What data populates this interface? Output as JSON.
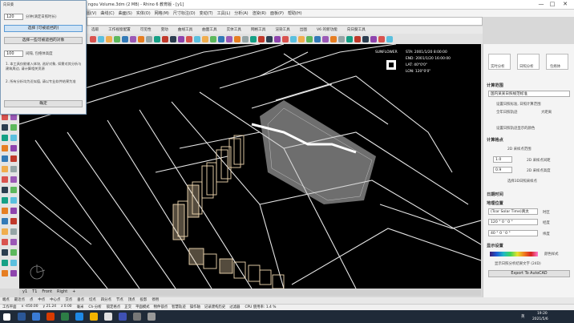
{
  "window": {
    "title": "ngou Volume.3dm (2 MB) - Rhino 6 教育版 - [y1]",
    "minimize": "—",
    "maximize": "□",
    "close": "✕"
  },
  "menubar": [
    "图(V)",
    "曲线(C)",
    "曲面(S)",
    "实体(O)",
    "网格(M)",
    "尺寸标注(D)",
    "变动(T)",
    "工具(L)",
    "分析(A)",
    "渲染(R)",
    "面板(P)",
    "帮助(H)"
  ],
  "ribbon_tabs": [
    "选取",
    "工作视窗配置",
    "可见性",
    "变动",
    "曲线工具",
    "曲面工具",
    "实体工具",
    "网格工具",
    "渲染工具",
    "出图",
    "V6 的新功能",
    "向日葵工具"
  ],
  "dialog": {
    "title": "向日葵",
    "row1_value": "120",
    "row1_label": "分钟(滴定日照时长)",
    "btn_select_objects": "选择 (可被遮挡的)",
    "btn_select_points": "选择一些可被遮挡的对象",
    "row2_value": "100",
    "row2_label": "间隔, 包络体高度",
    "note1": "1. 本工具仅能输入体块, 选好对象, 如需对其分析与建筑周边, 请计算相关资源",
    "note2": "2. 所有分析均为近似值, 请以专业软件结果为准",
    "ok": "确定"
  },
  "viewport": {
    "labels": [
      "SUNFLOWER",
      "STA: 2001/1/20 8:00:00",
      "END: 2001/1/20 16:00:00",
      "LAT: 40°0'0\"",
      "LON: 120°0'0\""
    ]
  },
  "viewport_tabs": [
    "y1",
    "T1",
    "Front",
    "Right",
    "+"
  ],
  "osnap": [
    "端点",
    "最近点",
    "点",
    "中点",
    "中心点",
    "交点",
    "垂点",
    "切点",
    "四分点",
    "节点",
    "顶点",
    "投影",
    "停用"
  ],
  "status": {
    "plane": "工作平面",
    "x": "x -450.00",
    "y": "y 21.24",
    "z": "z 0.00",
    "unit": "毫米",
    "layer": "Ch-分析",
    "toggles": [
      "锁定格点",
      "正交",
      "平面模式",
      "物件锁点",
      "智慧轨迹",
      "操作轴",
      "记录建构历史",
      "过滤器"
    ],
    "cpu": "CPU 使用率: 1.4 %"
  },
  "rightpanel": {
    "top_buttons": [
      "实时分析",
      "日照分析",
      "包络体"
    ],
    "sec_calc_range": "计算范围",
    "dropdown_standard": "国内某某日照规范标准",
    "opt_set_date": "设置日照标准, 日照计算范围",
    "opt_all_day": "全年日照轨迹",
    "opt_large": "大距离",
    "opt_color": "设置日照轨迹显示的颜色",
    "sec_calc_points": "计算格点",
    "pts_label": "2D 采样点范围",
    "val1": "1.0",
    "val1_label": "2D 采样点间距",
    "val2": "0.9",
    "val2_label": "2D 采样点高度",
    "sel_pts": "选择3D日照采样点",
    "sec_datetime": "日期时间",
    "sec_geo": "地理位置",
    "tz": "(Tcor Solar Time)真太",
    "tz_label": "时区",
    "lon": "120 ° 0 ' 0 \"",
    "lon_label": "经度",
    "lat": "40 ° 0 ' 0 \"",
    "lat_label": "纬度",
    "sec_display": "显示设置",
    "color_label": "颜色样式",
    "show_text": "显示日照分析结果文字 (24D)",
    "export": "Export To AutoCAD"
  },
  "taskbar": {
    "time": "19:20",
    "date": "2021/5/6",
    "lang": "英"
  }
}
